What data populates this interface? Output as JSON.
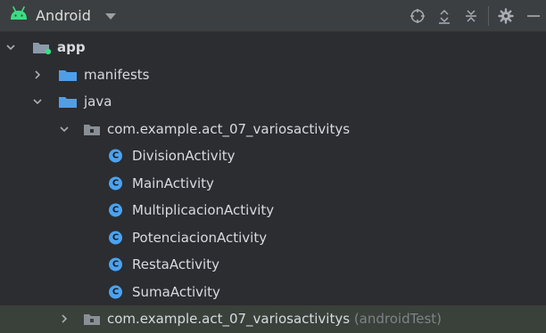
{
  "toolbar": {
    "view_title": "Android",
    "icons": [
      "crosshair-icon",
      "expand-all-icon",
      "collapse-all-icon",
      "gear-icon",
      "minimize-icon"
    ]
  },
  "colors": {
    "background": "#2b2d30",
    "toolbar": "#3c3f41",
    "folder": "#4f9ee8",
    "class_icon": "#4aa3f2",
    "android_green": "#3ddc84",
    "selected_row": "#39413a"
  },
  "tree": {
    "app": "app",
    "manifests": "manifests",
    "java": "java",
    "package_main": "com.example.act_07_variosactivitys",
    "classes": [
      "DivisionActivity",
      "MainActivity",
      "MultiplicacionActivity",
      "PotenciacionActivity",
      "RestaActivity",
      "SumaActivity"
    ],
    "class_icon_letter": "C",
    "package_test": "com.example.act_07_variosactivitys",
    "package_test_suffix": "(androidTest)"
  }
}
